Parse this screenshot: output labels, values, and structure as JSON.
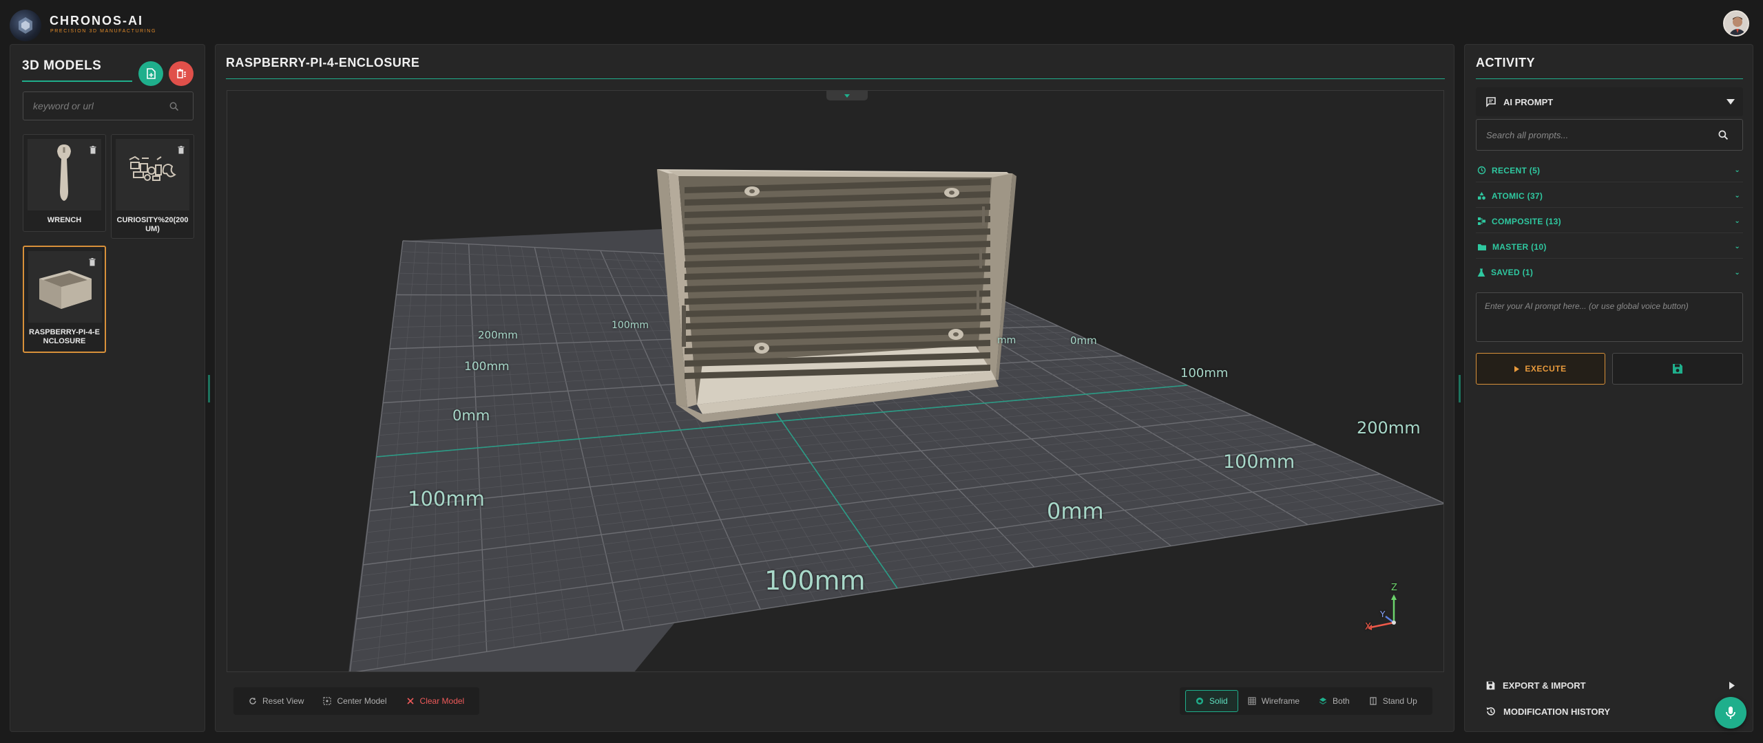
{
  "app": {
    "name": "CHRONOS-AI",
    "tagline": "PRECISION 3D MANUFACTURING"
  },
  "colors": {
    "accent": "#1faf8c",
    "warning": "#d9913a",
    "danger": "#ef5a5a",
    "panel": "#262626",
    "background": "#1b1b1b"
  },
  "left": {
    "title": "3D MODELS",
    "add_icon": "file-add-icon",
    "delete_icon": "delete-all-icon",
    "search_placeholder": "keyword or url",
    "models": [
      {
        "name": "WRENCH",
        "icon": "wrench-model-thumbnail",
        "selected": false
      },
      {
        "name": "CURIOSITY%20(200UM)",
        "icon": "rover-parts-thumbnail",
        "selected": false
      },
      {
        "name": "RASPBERRY-PI-4-ENCLOSURE",
        "icon": "enclosure-thumbnail",
        "selected": true
      }
    ]
  },
  "center": {
    "title": "RASPBERRY-PI-4-ENCLOSURE",
    "grid_labels": {
      "far_200": "200mm",
      "far_100_top": "100mm",
      "left_100_small": "100mm",
      "left_0": "0mm",
      "left_100_large": "100mm",
      "front_100": "100mm",
      "right_0_top": "0mm",
      "right_100_top": "100mm",
      "right_mm": "mm",
      "right_200": "200mm",
      "right_100_mid": "100mm",
      "center_0": "0mm"
    },
    "axes": {
      "x": "X",
      "y": "Y",
      "z": "Z"
    },
    "toolbar_left": [
      {
        "label": "Reset View",
        "icon": "reset-view-icon"
      },
      {
        "label": "Center Model",
        "icon": "center-model-icon"
      },
      {
        "label": "Clear Model",
        "icon": "close-icon"
      }
    ],
    "toolbar_right": [
      {
        "label": "Solid",
        "icon": "solid-cube-icon",
        "active": true
      },
      {
        "label": "Wireframe",
        "icon": "wireframe-grid-icon",
        "active": false
      },
      {
        "label": "Both",
        "icon": "layers-icon",
        "active": false
      },
      {
        "label": "Stand Up",
        "icon": "stand-up-icon",
        "active": false
      }
    ]
  },
  "right": {
    "title": "ACTIVITY",
    "ai_prompt_label": "AI PROMPT",
    "search_placeholder": "Search all prompts...",
    "categories": [
      {
        "label": "RECENT (5)",
        "icon": "history-icon"
      },
      {
        "label": "ATOMIC (37)",
        "icon": "shapes-icon"
      },
      {
        "label": "COMPOSITE (13)",
        "icon": "hierarchy-icon"
      },
      {
        "label": "MASTER (10)",
        "icon": "folder-icon"
      },
      {
        "label": "SAVED (1)",
        "icon": "flask-icon"
      }
    ],
    "prompt_placeholder": "Enter your AI prompt here... (or use global voice button)",
    "execute_label": "EXECUTE",
    "save_icon": "save-icon",
    "export_label": "EXPORT & IMPORT",
    "history_label": "MODIFICATION HISTORY"
  }
}
